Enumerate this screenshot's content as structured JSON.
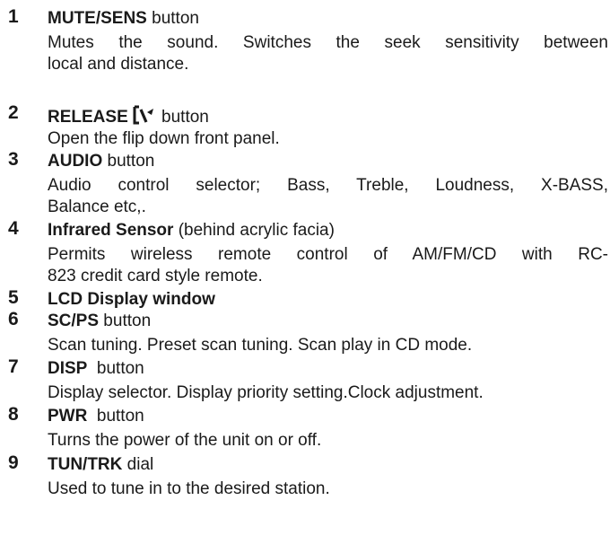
{
  "items": [
    {
      "number": "1",
      "name": "MUTE/SENS",
      "suffix": " button",
      "desc_lines": [
        "Mutes the sound. Switches the seek sensitivity between",
        "local and distance."
      ]
    },
    {
      "number": "2",
      "name": "RELEASE",
      "suffix": " button",
      "icon": "release-panel-icon",
      "desc_lines": [
        "Open the flip down front panel."
      ]
    },
    {
      "number": "3",
      "name": "AUDIO",
      "suffix": " button",
      "desc_lines": [
        "Audio control selector; Bass, Treble, Loudness, X-BASS,",
        "Balance etc,."
      ]
    },
    {
      "number": "4",
      "name": "Infrared Sensor",
      "suffix": " (behind  acrylic facia)",
      "desc_lines": [
        "Permits wireless remote control of AM/FM/CD with RC-",
        "823 credit card style remote."
      ]
    },
    {
      "number": "5",
      "name": "LCD Display window",
      "suffix": "",
      "desc_lines": []
    },
    {
      "number": "6",
      "name": "SC/PS",
      "suffix": " button",
      "desc_lines": [
        "Scan tuning. Preset scan tuning. Scan play in CD mode."
      ]
    },
    {
      "number": "7",
      "name": "DISP",
      "suffix": "  button",
      "desc_lines": [
        "Display selector. Display priority setting.Clock adjustment."
      ]
    },
    {
      "number": "8",
      "name": "PWR",
      "suffix": "  button",
      "desc_lines": [
        "Turns the power of the unit on or off."
      ]
    },
    {
      "number": "9",
      "name": "TUN/TRK",
      "suffix": " dial",
      "desc_lines": [
        "Used to tune in to the desired station."
      ]
    }
  ]
}
